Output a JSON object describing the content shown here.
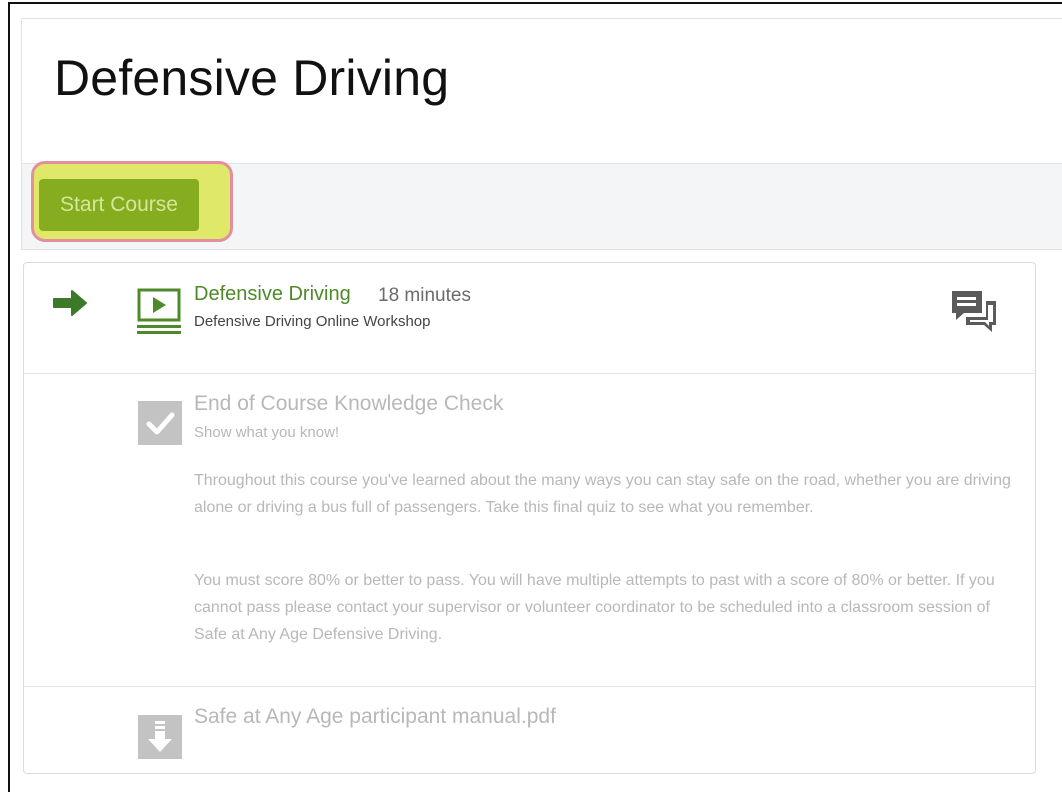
{
  "page": {
    "title": "Defensive Driving"
  },
  "toolbar": {
    "start_label": "Start Course"
  },
  "lessons": [
    {
      "title": "Defensive Driving",
      "duration": "18 minutes",
      "subtitle": "Defensive Driving Online Workshop",
      "status": "current",
      "icon": "video-icon",
      "action_icon": "discussion-icon"
    },
    {
      "title": "End of Course Knowledge Check",
      "subtitle": "Show what you know!",
      "status": "locked",
      "icon": "checkmark-icon",
      "paragraphs": [
        "Throughout this course you've learned about the many ways you can stay safe on the road, whether you are driving alone or driving a bus full of passengers.  Take this final quiz to see what you remember.",
        "You must score 80% or better to pass.  You will have multiple attempts to past with a score of 80% or better.  If you cannot pass please contact your supervisor or volunteer coordinator to be scheduled into a classroom session of Safe at Any Age Defensive Driving."
      ]
    },
    {
      "title": "Safe at Any Age participant manual.pdf",
      "status": "locked",
      "icon": "download-icon"
    }
  ],
  "colors": {
    "accent_green": "#86ac20",
    "lesson_green": "#4e8a2a",
    "highlight_yellow": "#dfe868",
    "highlight_border": "#e38f9e",
    "muted_gray": "#b8b8b8"
  }
}
